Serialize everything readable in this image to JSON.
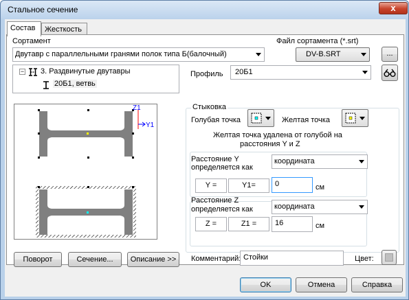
{
  "window": {
    "title": "Стальное сечение",
    "close_glyph": "x"
  },
  "tabs": [
    {
      "label": "Состав",
      "active": true
    },
    {
      "label": "Жесткость",
      "active": false
    }
  ],
  "assortment": {
    "label": "Сортамент",
    "value": "Двутавр с параллельными гранями полок типа Б(балочный)"
  },
  "assortment_file": {
    "label": "Файл сортамента (*.srt)",
    "value": "DV-B.SRT",
    "browse_label": "..."
  },
  "tree": {
    "parent": "3. Раздвинутые двутавры",
    "child": "20Б1, ветвь",
    "expand_glyph": "−"
  },
  "profile": {
    "label": "Профиль",
    "value": "20Б1"
  },
  "junction": {
    "title": "Стыковка",
    "blue_point_label": "Голубая точка",
    "yellow_point_label": "Желтая точка",
    "description_line1": "Желтая точка удалена от голубой на",
    "description_line2": "расстояния  Y и  Z",
    "distance_y": {
      "label_line1": "Расстояние Y",
      "label_line2": "определяется как",
      "mode": "координата",
      "name1": "Y =",
      "name2": "Y1=",
      "value": "0",
      "unit": "см"
    },
    "distance_z": {
      "label_line1": "Расстояние Z",
      "label_line2": "определяется как",
      "mode": "координата",
      "name1": "Z =",
      "name2": "Z1 =",
      "value": "16",
      "unit": "см"
    }
  },
  "axes": {
    "z_label": "Z1",
    "y_label": "Y1"
  },
  "bottom": {
    "rotate_label": "Поворот",
    "section_label": "Сечение...",
    "description_label": "Описание >>",
    "comment_label": "Комментарий:",
    "comment_value": "Стойки",
    "color_label": "Цвет:"
  },
  "dialog_buttons": {
    "ok": "OK",
    "cancel": "Отмена",
    "help": "Справка"
  },
  "colors": {
    "section_fill": "#808080",
    "yellow_point": "#ffff00",
    "blue_point": "#00ffff",
    "axis_blue": "#0000ff",
    "axis_red": "#ff0000"
  }
}
